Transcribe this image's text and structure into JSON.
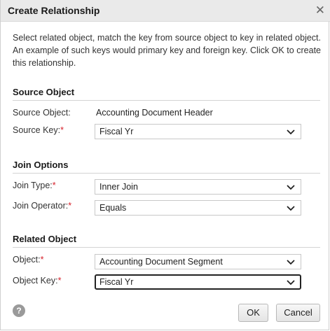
{
  "dialog": {
    "title": "Create Relationship",
    "close_glyph": "✕",
    "description": "Select related object, match the key from source object to key in related object. An example of such keys would primary key and foreign key. Click OK to create this relationship."
  },
  "source": {
    "heading": "Source Object",
    "object_label": "Source Object:",
    "object_value": "Accounting Document Header",
    "key_label": "Source Key:",
    "key_value": "Fiscal Yr"
  },
  "join": {
    "heading": "Join Options",
    "type_label": "Join Type:",
    "type_value": "Inner Join",
    "operator_label": "Join Operator:",
    "operator_value": "Equals"
  },
  "related": {
    "heading": "Related Object",
    "object_label": "Object:",
    "object_value": "Accounting Document Segment",
    "key_label": "Object Key:",
    "key_value": "Fiscal Yr"
  },
  "required_marker": "*",
  "footer": {
    "help_glyph": "?",
    "ok_label": "OK",
    "cancel_label": "Cancel"
  },
  "colors": {
    "title_bar": "#eaeaea",
    "required": "#d6202a",
    "divider": "#d4d4d4"
  },
  "icons": {
    "close": "close-icon",
    "dropdown": "chevron-down-icon",
    "help": "help-icon"
  }
}
